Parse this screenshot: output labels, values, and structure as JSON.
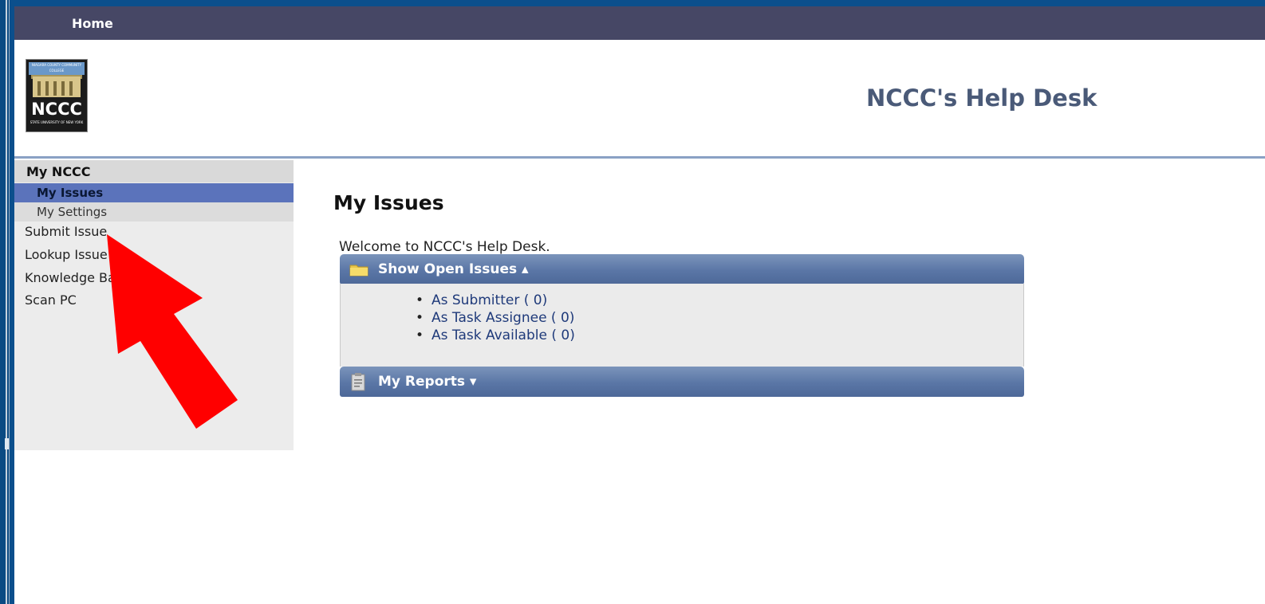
{
  "topbar": {
    "home_label": "Home"
  },
  "header": {
    "logo": {
      "text": "NCCC",
      "band_text": "NIAGARA COUNTY COMMUNITY COLLEGE",
      "sub_text": "STATE UNIVERSITY OF NEW YORK"
    },
    "title": "NCCC's Help Desk"
  },
  "sidebar": {
    "section": "My NCCC",
    "sub_items": [
      {
        "label": "My Issues",
        "active": true
      },
      {
        "label": "My Settings",
        "active": false
      }
    ],
    "items": [
      {
        "label": "Submit Issue"
      },
      {
        "label": "Lookup Issue"
      },
      {
        "label": "Knowledge Base"
      },
      {
        "label": "Scan PC"
      }
    ]
  },
  "main": {
    "title": "My Issues",
    "welcome": "Welcome to NCCC's Help Desk.",
    "open_issues": {
      "header": "Show Open Issues ▴",
      "icon": "folder-icon",
      "items": [
        {
          "label": "As Submitter (   0)"
        },
        {
          "label": "As Task Assignee (   0)"
        },
        {
          "label": "As Task Available (   0)"
        }
      ]
    },
    "reports": {
      "header": "My Reports ▾",
      "icon": "clipboard-icon"
    }
  },
  "annotation": {
    "icon": "red-arrow-icon",
    "color": "#ff0000"
  },
  "colors": {
    "topbar": "#464765",
    "panel_header": "#5a76a6",
    "sidebar_active": "#5b73bb",
    "title": "#4a5a78"
  }
}
